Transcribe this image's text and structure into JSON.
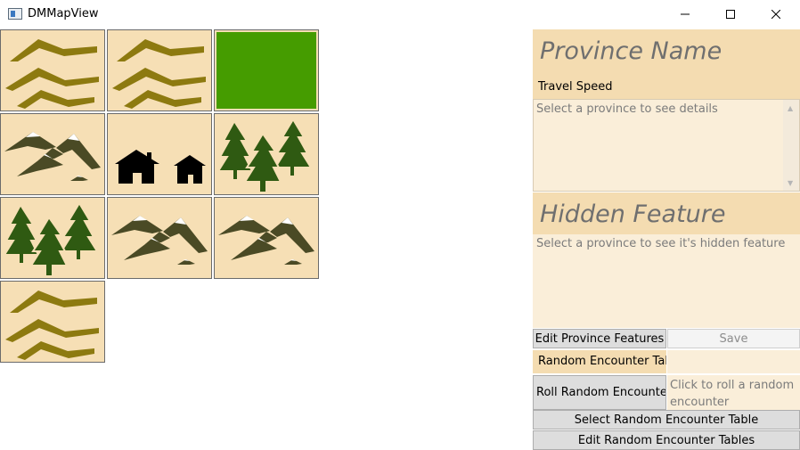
{
  "window": {
    "title": "DMMapView",
    "controls": [
      "minimize-icon",
      "maximize-icon",
      "close-icon"
    ]
  },
  "map": {
    "tile_background": "#f6dfb5",
    "tiles": [
      {
        "row": 1,
        "col": 1,
        "terrain": "hills"
      },
      {
        "row": 1,
        "col": 2,
        "terrain": "hills"
      },
      {
        "row": 1,
        "col": 3,
        "terrain": "grassland",
        "color": "#459c00"
      },
      {
        "row": 2,
        "col": 1,
        "terrain": "mountains"
      },
      {
        "row": 2,
        "col": 2,
        "terrain": "settlement"
      },
      {
        "row": 2,
        "col": 3,
        "terrain": "forest"
      },
      {
        "row": 3,
        "col": 1,
        "terrain": "forest"
      },
      {
        "row": 3,
        "col": 2,
        "terrain": "mountains"
      },
      {
        "row": 3,
        "col": 3,
        "terrain": "mountains"
      },
      {
        "row": 4,
        "col": 1,
        "terrain": "hills"
      }
    ]
  },
  "panel": {
    "province_name": "Province Name",
    "travel_speed_label": "Travel Speed",
    "details_placeholder": "Select a province to see details",
    "hidden_feature_title": "Hidden Feature",
    "hidden_feature_placeholder": "Select a province to see it's hidden feature",
    "edit_features_button": "Edit Province Features",
    "save_button": "Save",
    "random_encounter_table_label": "Random Encounter Table",
    "roll_button": "Roll Random Encounter",
    "roll_result_placeholder": "Click to roll a random encounter",
    "select_table_button": "Select Random Encounter Table",
    "edit_tables_button": "Edit Random Encounter Tables",
    "colors": {
      "header": "#f4dcb1",
      "field": "#faeed9",
      "placeholder_text": "#7b7b7b"
    }
  }
}
